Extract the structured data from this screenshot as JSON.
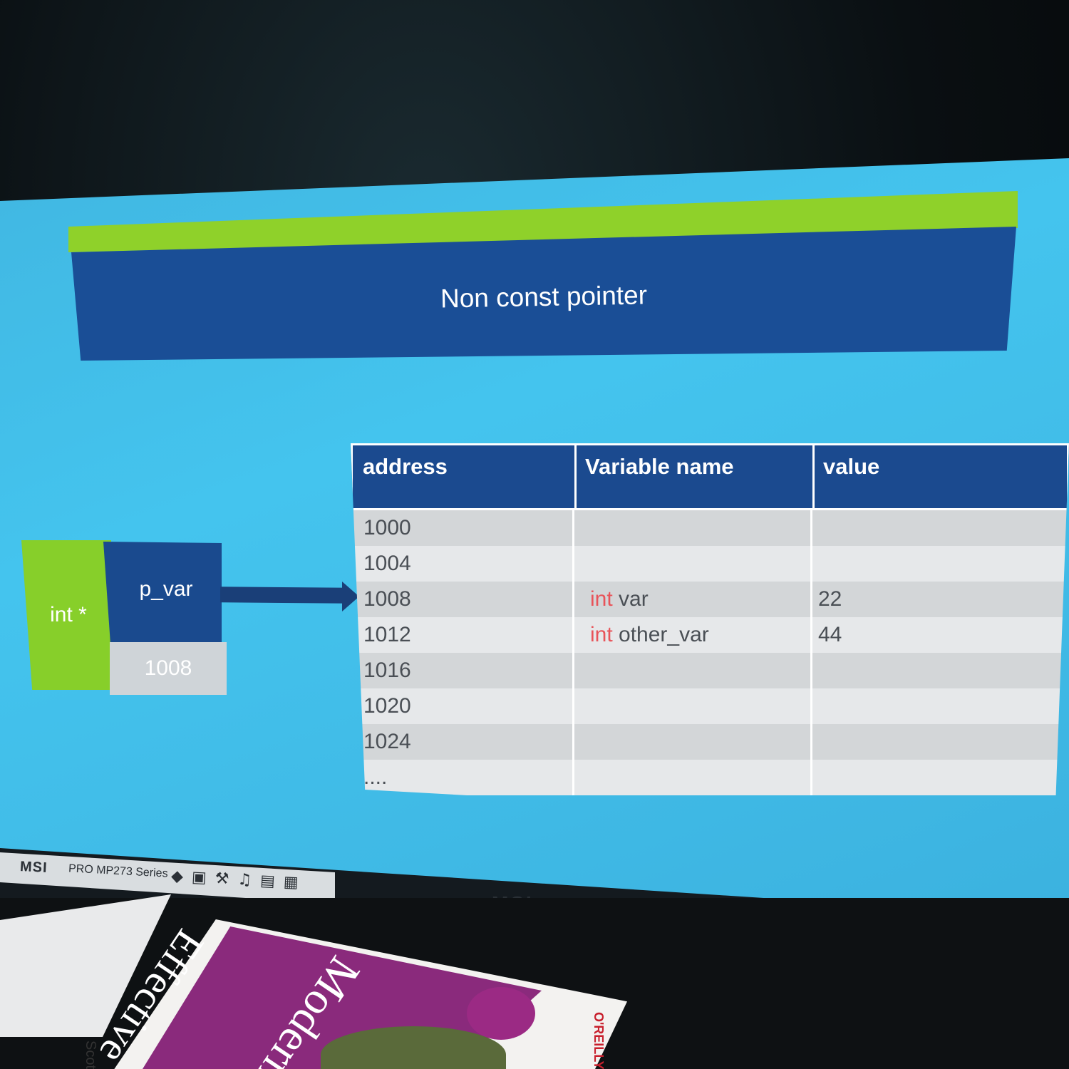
{
  "slide": {
    "title": "Non const pointer"
  },
  "pointer": {
    "type": "int *",
    "name": "p_var",
    "value": "1008"
  },
  "memory_table": {
    "headers": [
      "address",
      "Variable name",
      "value"
    ],
    "rows": [
      {
        "address": "1000",
        "type_kw": "",
        "var": "",
        "value": ""
      },
      {
        "address": "1004",
        "type_kw": "",
        "var": "",
        "value": ""
      },
      {
        "address": "1008",
        "type_kw": "int",
        "var": "var",
        "value": "22"
      },
      {
        "address": "1012",
        "type_kw": "int",
        "var": "other_var",
        "value": "44"
      },
      {
        "address": "1016",
        "type_kw": "",
        "var": "",
        "value": ""
      },
      {
        "address": "1020",
        "type_kw": "",
        "var": "",
        "value": ""
      },
      {
        "address": "1024",
        "type_kw": "",
        "var": "",
        "value": ""
      },
      {
        "address": "....",
        "type_kw": "",
        "var": "",
        "value": ""
      }
    ]
  },
  "monitor": {
    "brand": "MSI",
    "model": "PRO MP273 Series"
  },
  "book": {
    "title": "Effective",
    "subtitle": "Modern",
    "publisher": "O'REILLY",
    "author": "Scott"
  },
  "colors": {
    "screen_bg": "#44c4ee",
    "title_bar": "#1a4e96",
    "accent_green": "#8fd12a",
    "keyword_red": "#e8545a"
  }
}
